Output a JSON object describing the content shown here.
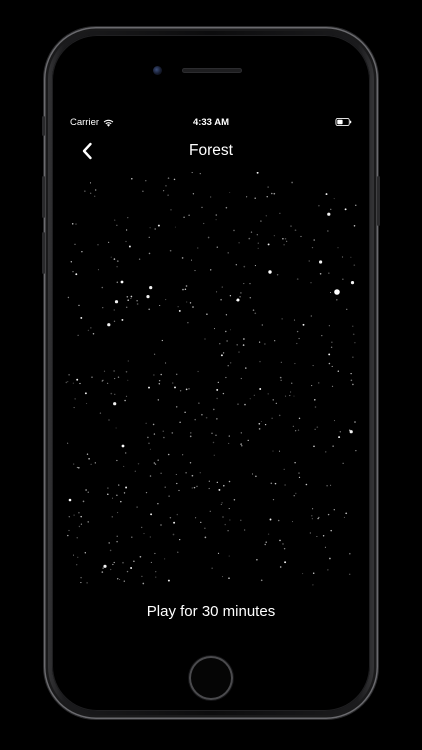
{
  "status_bar": {
    "carrier": "Carrier",
    "time": "4:33 AM",
    "wifi_icon": "wifi-icon",
    "battery_icon": "battery-icon"
  },
  "nav": {
    "back_icon": "chevron-left-icon",
    "title": "Forest"
  },
  "content": {
    "play_label": "Play for 30 minutes"
  },
  "colors": {
    "background": "#000000",
    "text": "#ffffff",
    "star": "#ffffff"
  }
}
